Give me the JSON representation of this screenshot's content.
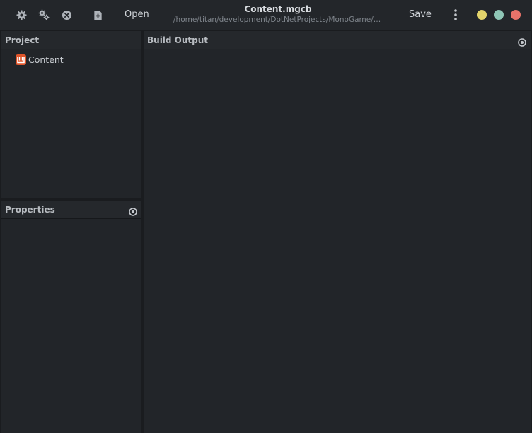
{
  "header": {
    "toolbar_icons": [
      "gear-icon",
      "cogs-icon",
      "close-circle-icon",
      "new-file-icon"
    ],
    "open_label": "Open",
    "title": "Content.mgcb",
    "subtitle": "/home/titan/development/DotNetProjects/MonoGame/T...",
    "save_label": "Save",
    "menu_icon": "kebab-menu-icon",
    "window_controls": {
      "minimize_color": "#e3d46b",
      "maximize_color": "#8fc6b6",
      "close_color": "#e8736a"
    }
  },
  "project_panel": {
    "title": "Project",
    "items": [
      {
        "label": "Content",
        "icon": "monogame-icon",
        "icon_color": "#e0552a"
      }
    ]
  },
  "properties_panel": {
    "title": "Properties",
    "icon": "settings-icon"
  },
  "build_output_panel": {
    "title": "Build Output",
    "icon": "settings-icon"
  }
}
